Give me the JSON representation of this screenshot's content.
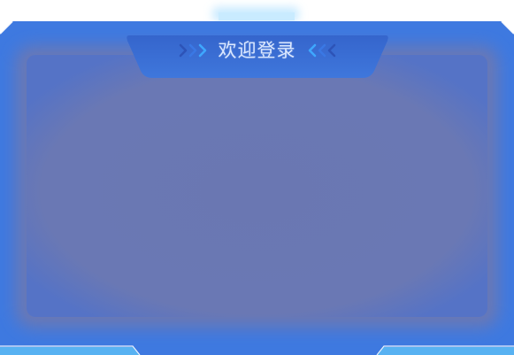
{
  "dialog": {
    "title": "欢迎登录"
  },
  "colors": {
    "frame_blue": "#3e79e0",
    "panel_inner": "#6a78b4",
    "title_tab": "#3a6fd2",
    "top_glow": "#bfe6ff",
    "bottom_accent": "#58b2f2",
    "chevron_bright": "#3ea7ff",
    "chevron_dim": "#2d54b8"
  },
  "icons": {
    "left": "double-chevron-right-icon",
    "right": "double-chevron-left-icon"
  }
}
